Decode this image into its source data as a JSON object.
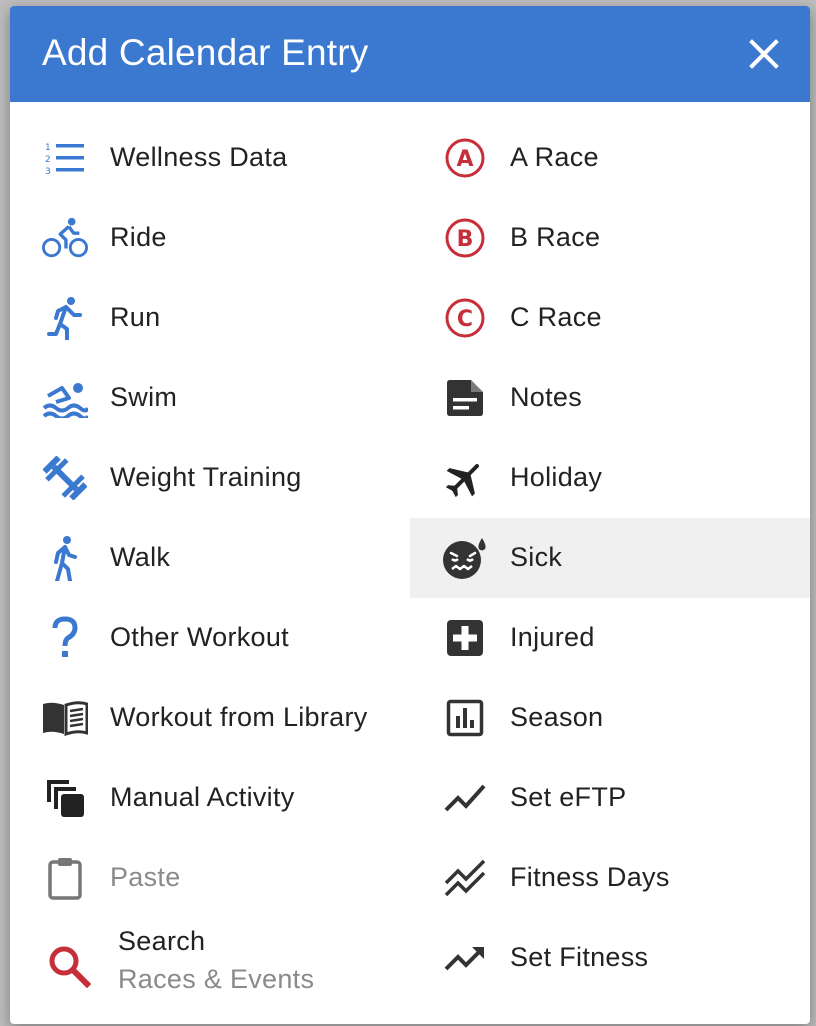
{
  "dialog": {
    "title": "Add Calendar Entry",
    "header_color": "#3b78cf"
  },
  "left_items": [
    {
      "label": "Wellness Data",
      "icon": "numbered-list-icon"
    },
    {
      "label": "Ride",
      "icon": "bike-icon"
    },
    {
      "label": "Run",
      "icon": "run-icon"
    },
    {
      "label": "Swim",
      "icon": "swim-icon"
    },
    {
      "label": "Weight Training",
      "icon": "dumbbell-icon"
    },
    {
      "label": "Walk",
      "icon": "walk-icon"
    },
    {
      "label": "Other Workout",
      "icon": "question-icon"
    },
    {
      "label": "Workout from Library",
      "icon": "book-icon"
    },
    {
      "label": "Manual Activity",
      "icon": "copy-icon"
    },
    {
      "label": "Paste",
      "icon": "clipboard-icon"
    },
    {
      "label": "Search",
      "sublabel": "Races & Events",
      "icon": "search-icon"
    }
  ],
  "right_items": [
    {
      "label": "A Race",
      "icon": "a-race-icon"
    },
    {
      "label": "B Race",
      "icon": "b-race-icon"
    },
    {
      "label": "C Race",
      "icon": "c-race-icon"
    },
    {
      "label": "Notes",
      "icon": "note-icon"
    },
    {
      "label": "Holiday",
      "icon": "airplane-icon"
    },
    {
      "label": "Sick",
      "icon": "sick-face-icon"
    },
    {
      "label": "Injured",
      "icon": "medical-cross-icon"
    },
    {
      "label": "Season",
      "icon": "bar-chart-icon"
    },
    {
      "label": "Set eFTP",
      "icon": "trend-line-icon"
    },
    {
      "label": "Fitness Days",
      "icon": "double-trend-icon"
    },
    {
      "label": "Set Fitness",
      "icon": "trending-up-icon"
    }
  ],
  "colors": {
    "blue": "#3b78cf",
    "red": "#c62f3a",
    "dark": "#333333",
    "disabled": "#8a8a8a"
  }
}
